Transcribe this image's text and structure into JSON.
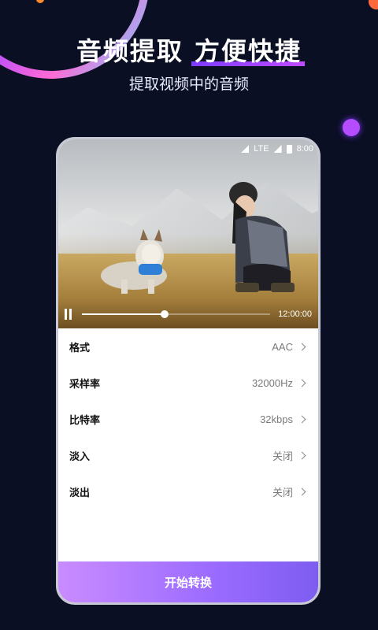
{
  "header": {
    "title_part1": "音频提取",
    "title_part2": "方便快捷",
    "subtitle": "提取视频中的音频"
  },
  "status_bar": {
    "network": "LTE",
    "time": "8:00"
  },
  "player": {
    "duration": "12:00:00",
    "progress": 0.44
  },
  "settings": [
    {
      "label": "格式",
      "value": "AAC"
    },
    {
      "label": "采样率",
      "value": "32000Hz"
    },
    {
      "label": "比特率",
      "value": "32kbps"
    },
    {
      "label": "淡入",
      "value": "关闭"
    },
    {
      "label": "淡出",
      "value": "关闭"
    }
  ],
  "actions": {
    "start_label": "开始转换"
  },
  "colors": {
    "background": "#0b0f24",
    "accent": "#9b6bff",
    "underline": "#7b3cff"
  }
}
